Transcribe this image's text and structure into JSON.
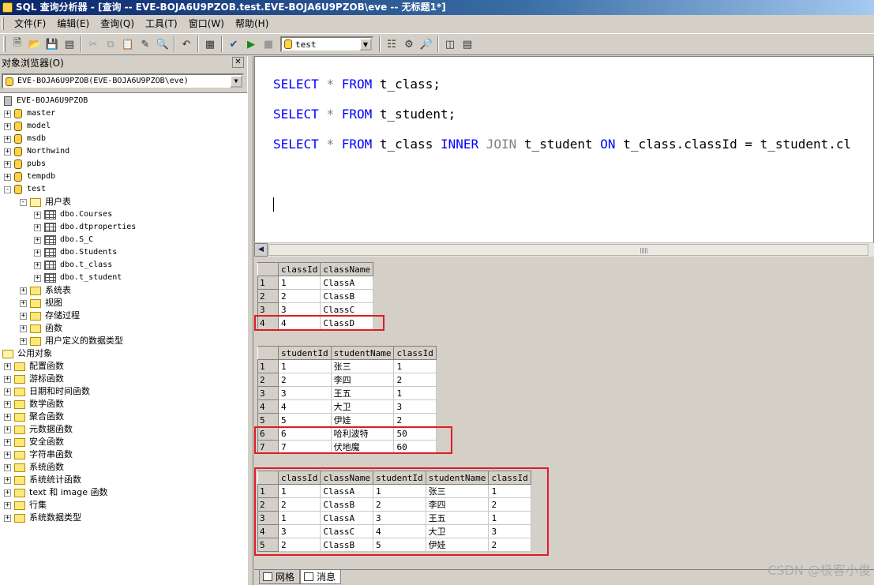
{
  "window": {
    "title": "SQL 查询分析器 - [查询 -- EVE-BOJA6U9PZOB.test.EVE-BOJA6U9PZOB\\eve -- 无标题1*]"
  },
  "menu": [
    "文件(F)",
    "编辑(E)",
    "查询(Q)",
    "工具(T)",
    "窗口(W)",
    "帮助(H)"
  ],
  "toolbar": {
    "database": "test"
  },
  "object_browser": {
    "title": "对象浏览器(O)",
    "close_label": "✕",
    "server_select": "EVE-BOJA6U9PZOB(EVE-BOJA6U9PZOB\\eve)",
    "server_node": "EVE-BOJA6U9PZOB",
    "databases": [
      "master",
      "model",
      "msdb",
      "Northwind",
      "pubs",
      "tempdb",
      "test"
    ],
    "user_tables_folder": "用户表",
    "tables": [
      "dbo.Courses",
      "dbo.dtproperties",
      "dbo.S_C",
      "dbo.Students",
      "dbo.t_class",
      "dbo.t_student"
    ],
    "test_folders": [
      "系统表",
      "视图",
      "存储过程",
      "函数",
      "用户定义的数据类型"
    ],
    "public_objects": "公用对象",
    "public_items": [
      "配置函数",
      "游标函数",
      "日期和时间函数",
      "数学函数",
      "聚合函数",
      "元数据函数",
      "安全函数",
      "字符串函数",
      "系统函数",
      "系统统计函数",
      "text 和 image 函数",
      "行集",
      "系统数据类型"
    ]
  },
  "editor": {
    "lines": [
      {
        "kw1": "SELECT",
        "op": "*",
        "kw2": "FROM",
        "rest": "t_class;"
      },
      {
        "kw1": "SELECT",
        "op": "*",
        "kw2": "FROM",
        "rest": "t_student;"
      },
      {
        "kw1": "SELECT",
        "op": "*",
        "kw2": "FROM",
        "rest": "t_class",
        "kw3": "INNER",
        "op2": "JOIN",
        "rest2": "t_student",
        "kw4": "ON",
        "rest3": "t_class.classId = t_student.cl"
      }
    ]
  },
  "results": {
    "grid1": {
      "columns": [
        "classId",
        "className"
      ],
      "rows": [
        [
          "1",
          "ClassA"
        ],
        [
          "2",
          "ClassB"
        ],
        [
          "3",
          "ClassC"
        ],
        [
          "4",
          "ClassD"
        ]
      ]
    },
    "grid2": {
      "columns": [
        "studentId",
        "studentName",
        "classId"
      ],
      "rows": [
        [
          "1",
          "张三",
          "1"
        ],
        [
          "2",
          "李四",
          "2"
        ],
        [
          "3",
          "王五",
          "1"
        ],
        [
          "4",
          "大卫",
          "3"
        ],
        [
          "5",
          "伊娃",
          "2"
        ],
        [
          "6",
          "哈利波特",
          "50"
        ],
        [
          "7",
          "伏地魔",
          "60"
        ]
      ]
    },
    "grid3": {
      "columns": [
        "classId",
        "className",
        "studentId",
        "studentName",
        "classId"
      ],
      "rows": [
        [
          "1",
          "ClassA",
          "1",
          "张三",
          "1"
        ],
        [
          "2",
          "ClassB",
          "2",
          "李四",
          "2"
        ],
        [
          "1",
          "ClassA",
          "3",
          "王五",
          "1"
        ],
        [
          "3",
          "ClassC",
          "4",
          "大卫",
          "3"
        ],
        [
          "2",
          "ClassB",
          "5",
          "伊娃",
          "2"
        ]
      ]
    }
  },
  "tabs": [
    "网格",
    "消息"
  ],
  "watermark": "CSDN @极客小俊",
  "colors": {
    "highlight": "#e01b24",
    "keyword": "#0000ff"
  }
}
